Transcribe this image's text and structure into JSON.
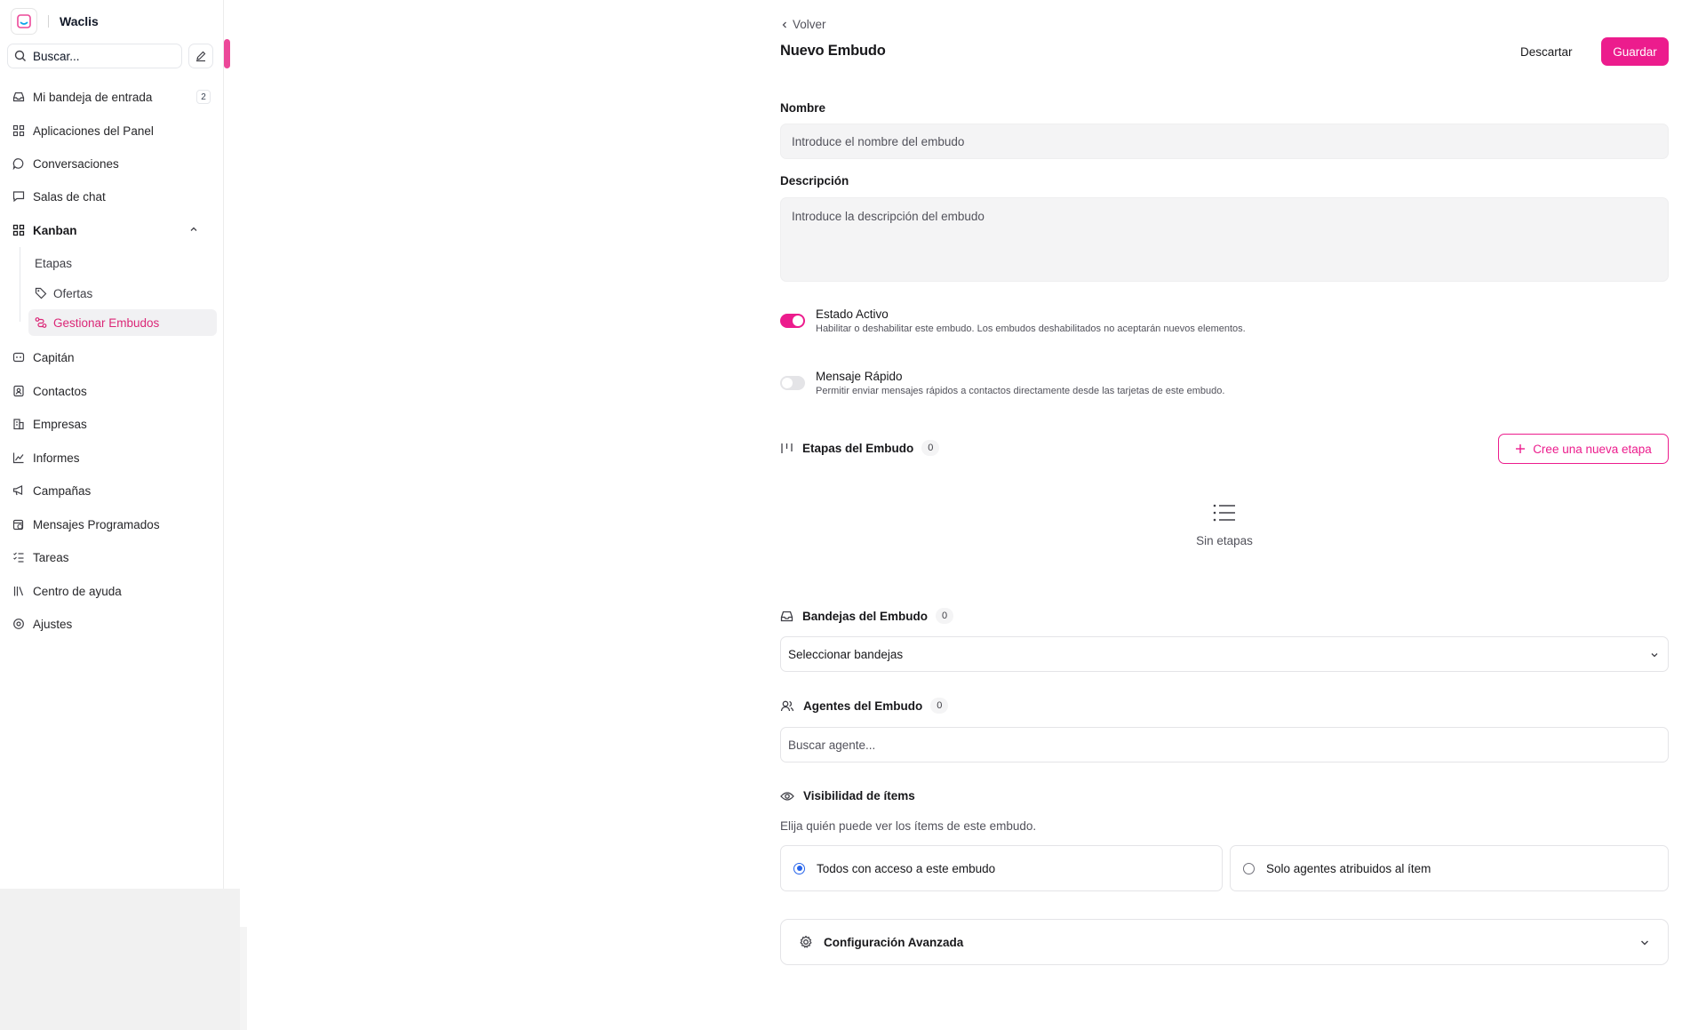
{
  "app": {
    "name": "Waclis"
  },
  "sidebar": {
    "search_placeholder": "Buscar...",
    "items": [
      {
        "label": "Mi bandeja de entrada",
        "badge": "2"
      },
      {
        "label": "Aplicaciones del Panel"
      },
      {
        "label": "Conversaciones"
      },
      {
        "label": "Salas de chat"
      },
      {
        "label": "Kanban"
      },
      {
        "label": "Capitán"
      },
      {
        "label": "Contactos"
      },
      {
        "label": "Empresas"
      },
      {
        "label": "Informes"
      },
      {
        "label": "Campañas"
      },
      {
        "label": "Mensajes Programados"
      },
      {
        "label": "Tareas"
      },
      {
        "label": "Centro de ayuda"
      },
      {
        "label": "Ajustes"
      }
    ],
    "kanban_sub": [
      {
        "label": "Etapas"
      },
      {
        "label": "Ofertas"
      },
      {
        "label": "Gestionar Embudos",
        "active": true
      }
    ]
  },
  "header": {
    "back_label": "Volver",
    "title": "Nuevo Embudo",
    "discard_label": "Descartar",
    "save_label": "Guardar"
  },
  "form": {
    "name_label": "Nombre",
    "name_placeholder": "Introduce el nombre del embudo",
    "description_label": "Descripción",
    "description_placeholder": "Introduce la descripción del embudo",
    "active": {
      "title": "Estado Activo",
      "description": "Habilitar o deshabilitar este embudo. Los embudos deshabilitados no aceptarán nuevos elementos.",
      "enabled": true
    },
    "quick_message": {
      "title": "Mensaje Rápido",
      "description": "Permitir enviar mensajes rápidos a contactos directamente desde las tarjetas de este embudo.",
      "enabled": false
    }
  },
  "stages": {
    "title": "Etapas del Embudo",
    "count": "0",
    "new_button": "Cree una nueva etapa",
    "empty_text": "Sin etapas"
  },
  "inboxes": {
    "title": "Bandejas del Embudo",
    "count": "0",
    "select_placeholder": "Seleccionar bandejas"
  },
  "agents": {
    "title": "Agentes del Embudo",
    "count": "0",
    "search_placeholder": "Buscar agente..."
  },
  "visibility": {
    "title": "Visibilidad de ítems",
    "description": "Elija quién puede ver los ítems de este embudo.",
    "options": [
      {
        "label": "Todos con acceso a este embudo",
        "selected": true
      },
      {
        "label": "Solo agentes atribuidos al ítem",
        "selected": false
      }
    ]
  },
  "advanced": {
    "title": "Configuración Avanzada"
  },
  "colors": {
    "accent": "#ec1c8d",
    "radio_selected": "#2563eb"
  }
}
